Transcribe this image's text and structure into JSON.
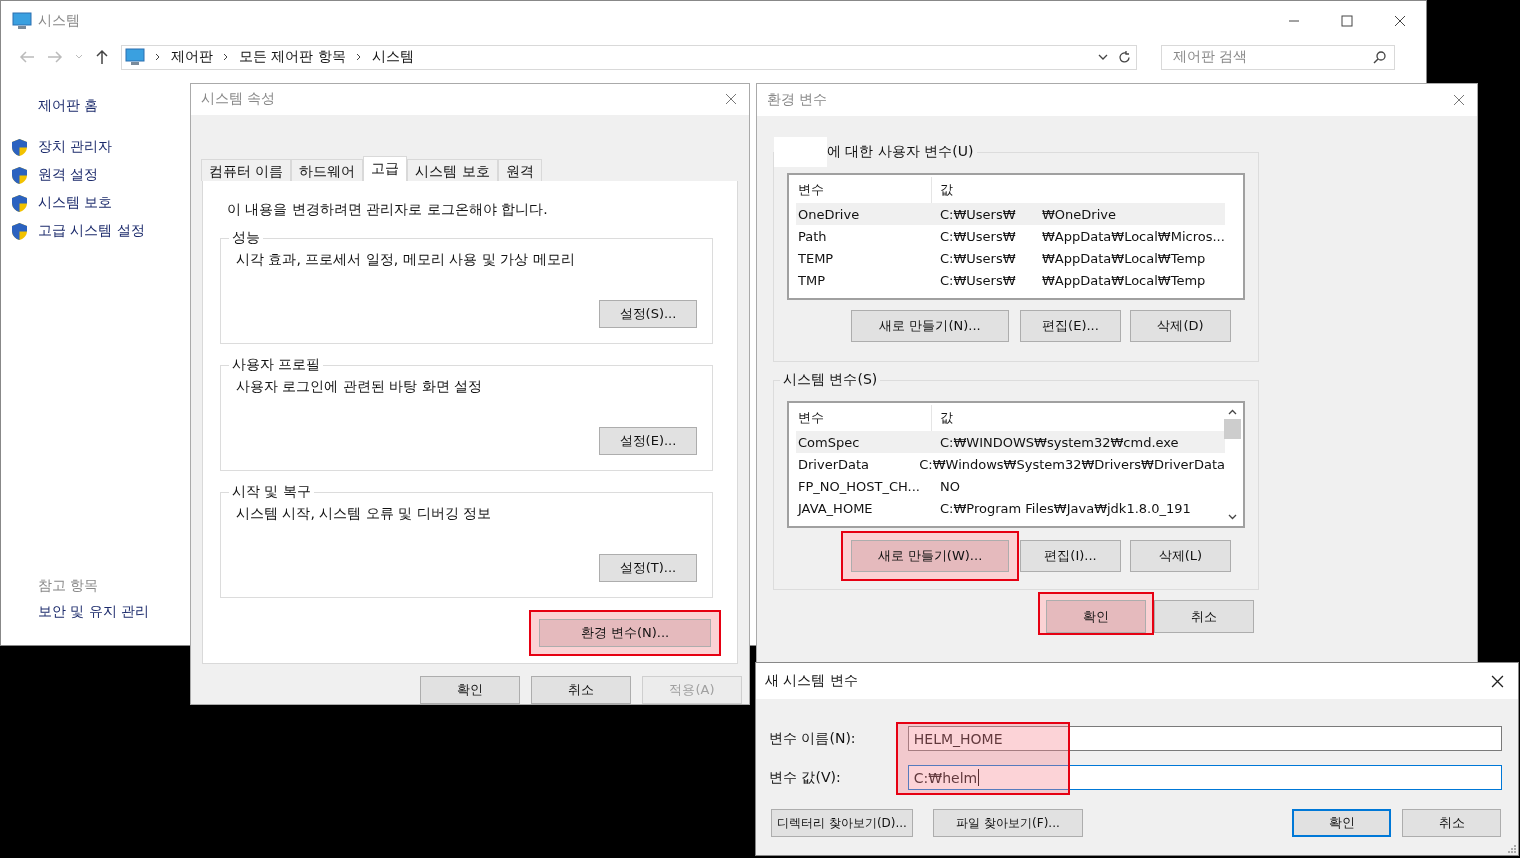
{
  "explorer": {
    "title": "시스템",
    "breadcrumb": [
      "제어판",
      "모든 제어판 항목",
      "시스템"
    ],
    "search": {
      "placeholder": "제어판 검색"
    },
    "home_link": "제어판 홈",
    "links": [
      "장치 관리자",
      "원격 설정",
      "시스템 보호",
      "고급 시스템 설정"
    ],
    "see_also": {
      "heading": "참고 항목",
      "links": [
        "보안 및 유지 관리"
      ]
    }
  },
  "system_properties": {
    "title": "시스템 속성",
    "tabs": [
      {
        "label": "컴퓨터 이름",
        "selected": false
      },
      {
        "label": "하드웨어",
        "selected": false
      },
      {
        "label": "고급",
        "selected": true
      },
      {
        "label": "시스템 보호",
        "selected": false
      },
      {
        "label": "원격",
        "selected": false
      }
    ],
    "notice": "이 내용을 변경하려면 관리자로 로그온해야 합니다.",
    "groups": [
      {
        "title": "성능",
        "description": "시각 효과, 프로세서 일정, 메모리 사용 및 가상 메모리",
        "button": "설정(S)..."
      },
      {
        "title": "사용자 프로필",
        "description": "사용자 로그인에 관련된 바탕 화면 설정",
        "button": "설정(E)..."
      },
      {
        "title": "시작 및 복구",
        "description": "시스템 시작, 시스템 오류 및 디버깅 정보",
        "button": "설정(T)..."
      }
    ],
    "env_button": {
      "label": "환경 변수(N)...",
      "highlighted": true
    },
    "buttons": [
      {
        "label": "확인",
        "disabled": false
      },
      {
        "label": "취소",
        "disabled": false
      },
      {
        "label": "적용(A)",
        "disabled": true
      }
    ]
  },
  "environment_variables": {
    "title": "환경 변수",
    "user_section": {
      "title": "에 대한 사용자 변수(U)",
      "columns": [
        "변수",
        "값"
      ],
      "rows": [
        {
          "name": "OneDrive",
          "value": "C:₩Users₩",
          "value_2": "₩OneDrive",
          "selected": true
        },
        {
          "name": "Path",
          "value": "C:₩Users₩",
          "value_2": "₩AppData₩Local₩Micros...",
          "selected": false
        },
        {
          "name": "TEMP",
          "value": "C:₩Users₩",
          "value_2": "₩AppData₩Local₩Temp",
          "selected": false
        },
        {
          "name": "TMP",
          "value": "C:₩Users₩",
          "value_2": "₩AppData₩Local₩Temp",
          "selected": false
        }
      ],
      "buttons": [
        {
          "label": "새로 만들기(N)...",
          "highlighted": false
        },
        {
          "label": "편집(E)...",
          "highlighted": false
        },
        {
          "label": "삭제(D)",
          "highlighted": false
        }
      ]
    },
    "system_section": {
      "title": "시스템 변수(S)",
      "columns": [
        "변수",
        "값"
      ],
      "rows": [
        {
          "name": "ComSpec",
          "value": "C:₩WINDOWS₩system32₩cmd.exe",
          "selected": true
        },
        {
          "name": "DriverData",
          "value": "C:₩Windows₩System32₩Drivers₩DriverData",
          "selected": false
        },
        {
          "name": "FP_NO_HOST_CH...",
          "value": "NO",
          "selected": false
        },
        {
          "name": "JAVA_HOME",
          "value": "C:₩Program Files₩Java₩jdk1.8.0_191",
          "selected": false
        }
      ],
      "buttons": [
        {
          "label": "새로 만들기(W)...",
          "highlighted": true
        },
        {
          "label": "편집(I)...",
          "highlighted": false
        },
        {
          "label": "삭제(L)",
          "highlighted": false
        }
      ]
    },
    "buttons": [
      {
        "label": "확인",
        "highlighted": true
      },
      {
        "label": "취소",
        "highlighted": false
      }
    ]
  },
  "new_variable": {
    "title": "새 시스템 변수",
    "highlighted": true,
    "fields": [
      {
        "label": "변수 이름(N):",
        "value": "HELM_HOME",
        "focused": false
      },
      {
        "label": "변수 값(V):",
        "value": "C:₩helm",
        "focused": true
      }
    ],
    "buttons": [
      {
        "label": "디렉터리 찾아보기(D)...",
        "default": false
      },
      {
        "label": "파일 찾아보기(F)...",
        "default": false
      },
      {
        "label": "확인",
        "default": true
      },
      {
        "label": "취소",
        "default": false
      }
    ]
  }
}
